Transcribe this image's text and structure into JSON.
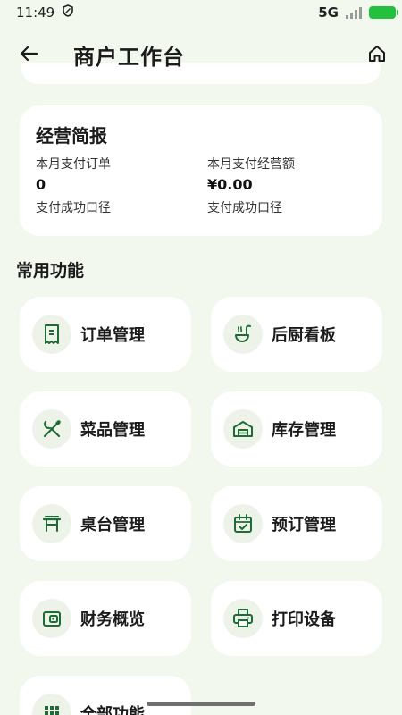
{
  "status_bar": {
    "time": "11:49",
    "network": "5G",
    "colors": {
      "battery": "#22c03c"
    }
  },
  "header": {
    "title": "商户工作台",
    "back_icon": "arrow-left-icon",
    "home_icon": "home-icon"
  },
  "report": {
    "title": "经营简报",
    "metrics": [
      {
        "label": "本月支付订单",
        "value": "0",
        "sub": "支付成功口径"
      },
      {
        "label": "本月支付经营额",
        "value": "¥0.00",
        "sub": "支付成功口径"
      }
    ]
  },
  "section": {
    "title": "常用功能"
  },
  "functions": [
    {
      "label": "订单管理",
      "icon": "receipt-icon"
    },
    {
      "label": "后厨看板",
      "icon": "ladle-icon"
    },
    {
      "label": "菜品管理",
      "icon": "utensils-icon"
    },
    {
      "label": "库存管理",
      "icon": "warehouse-icon"
    },
    {
      "label": "桌台管理",
      "icon": "table-icon"
    },
    {
      "label": "预订管理",
      "icon": "calendar-check-icon"
    },
    {
      "label": "财务概览",
      "icon": "wallet-icon"
    },
    {
      "label": "打印设备",
      "icon": "printer-icon"
    },
    {
      "label": "全部功能",
      "icon": "grid-icon"
    }
  ],
  "theme": {
    "accent": "#1f6b35",
    "background": "#f3f8ef"
  }
}
